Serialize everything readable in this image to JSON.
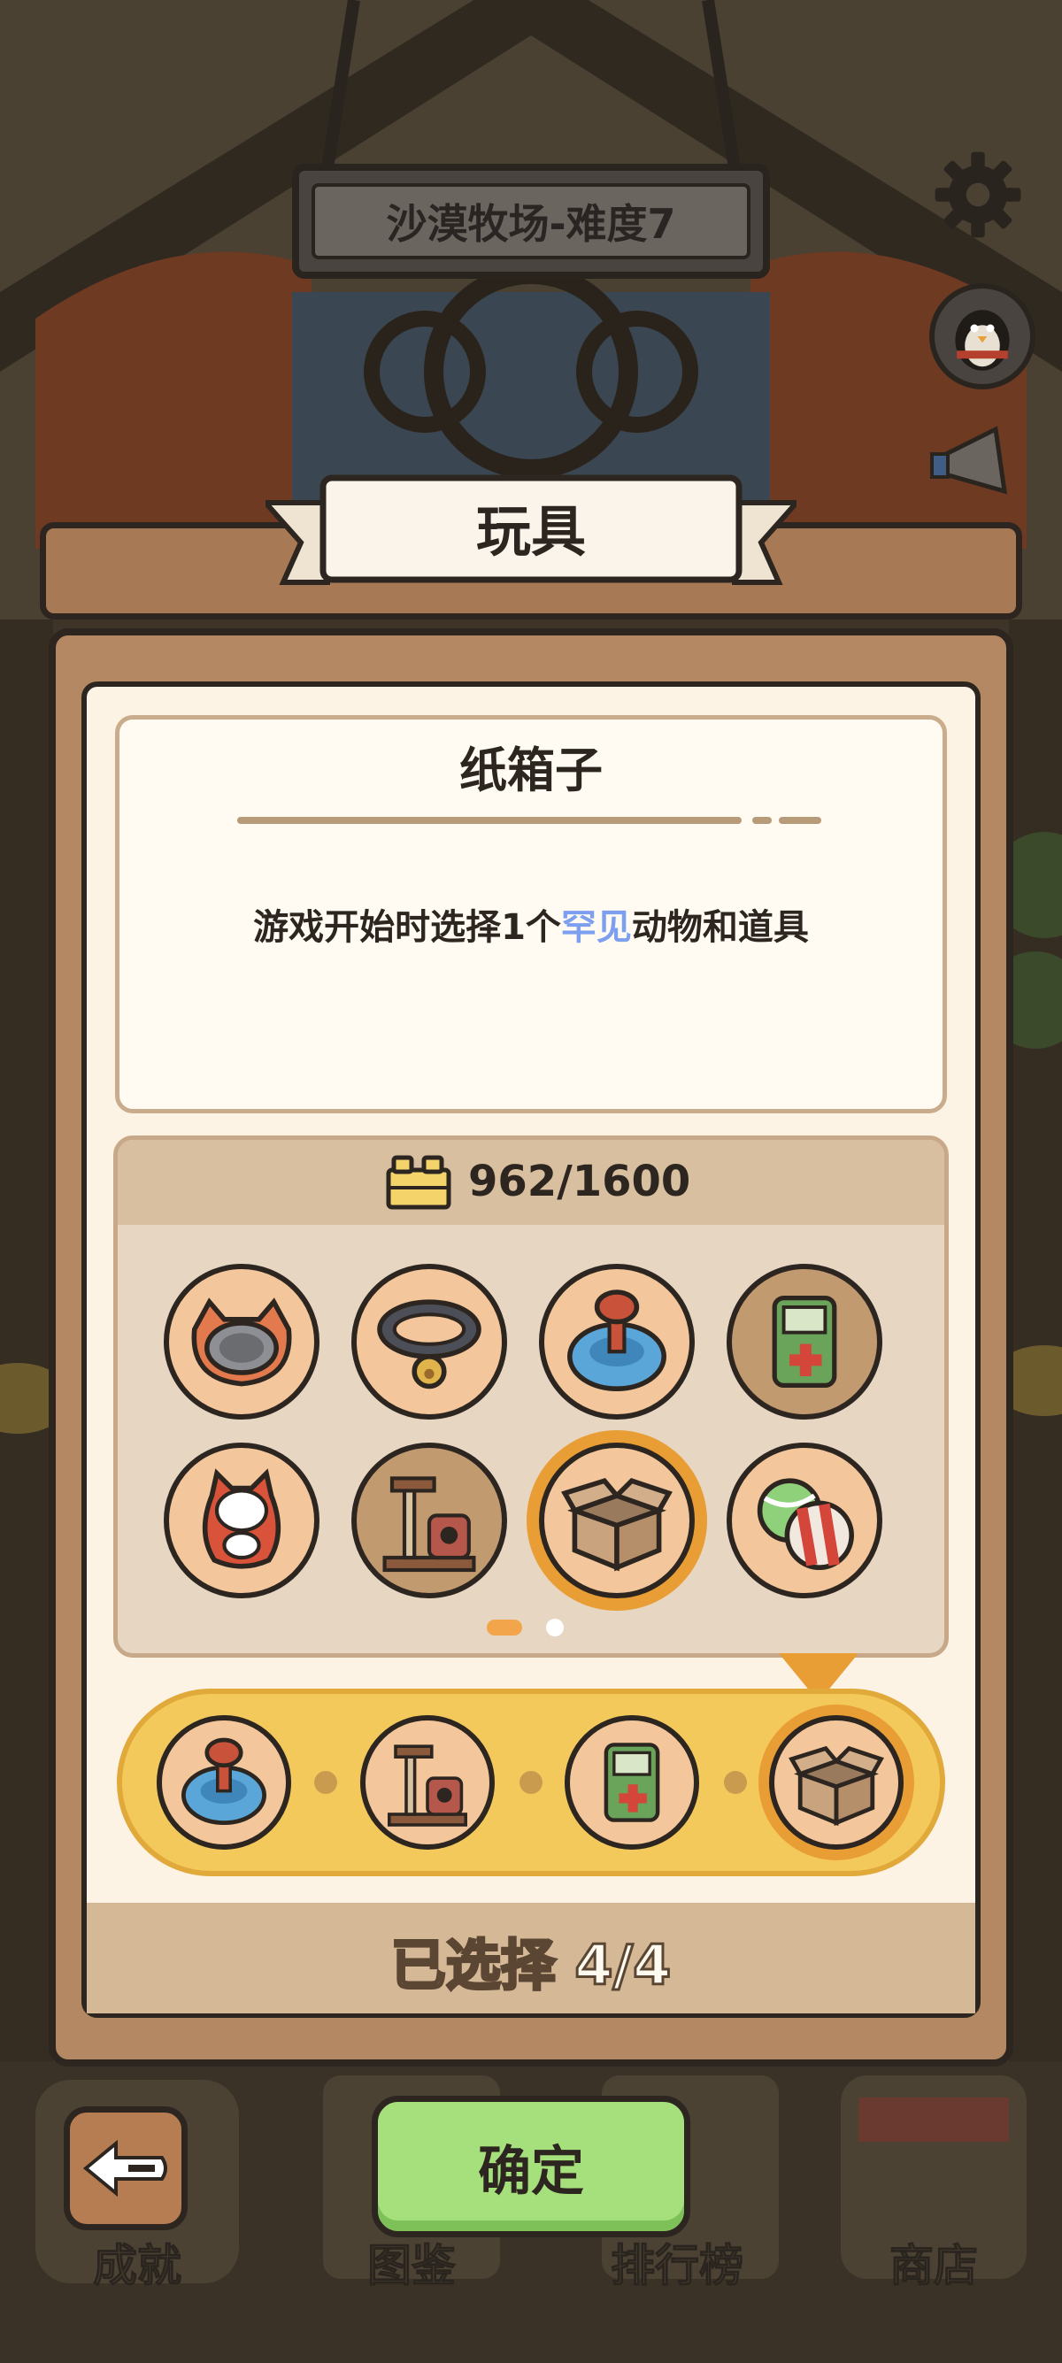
{
  "level": {
    "title": "沙漠牧场-难度7"
  },
  "panel": {
    "title": "玩具"
  },
  "selected_item": {
    "name": "纸箱子",
    "description_part1": "游戏开始时选择1个",
    "description_highlight": "罕见",
    "description_part2": "动物和道具"
  },
  "currency": {
    "count": "962/1600",
    "icon": "lego-brick-icon"
  },
  "toy_grid": [
    {
      "name": "pet-bowl",
      "icon": "pet-bowl-icon"
    },
    {
      "name": "collar",
      "icon": "collar-icon"
    },
    {
      "name": "spinner-toy",
      "icon": "spinner-toy-icon"
    },
    {
      "name": "game-console",
      "icon": "game-console-icon"
    },
    {
      "name": "cat-tumbler",
      "icon": "cat-tumbler-icon"
    },
    {
      "name": "cat-tree",
      "icon": "cat-tree-icon"
    },
    {
      "name": "cardboard-box",
      "icon": "cardboard-box-icon",
      "selected": true
    },
    {
      "name": "balls",
      "icon": "balls-icon"
    }
  ],
  "pagination": {
    "pages": 2,
    "current": 1
  },
  "chosen": [
    {
      "icon": "spinner-toy-icon"
    },
    {
      "icon": "cat-tree-icon"
    },
    {
      "icon": "game-console-icon"
    },
    {
      "icon": "cardboard-box-icon"
    }
  ],
  "footer": {
    "selected_count": "已选择 4/4"
  },
  "confirm_label": "确定",
  "bottom_nav": [
    {
      "label": "成就"
    },
    {
      "label": "图鉴"
    },
    {
      "label": "排行榜"
    },
    {
      "label": "商店"
    }
  ],
  "colors": {
    "accent_orange": "#e99d35",
    "highlight_blue": "#7c9ff0",
    "confirm_green": "#a6e07c",
    "panel_brown": "#b48862"
  }
}
